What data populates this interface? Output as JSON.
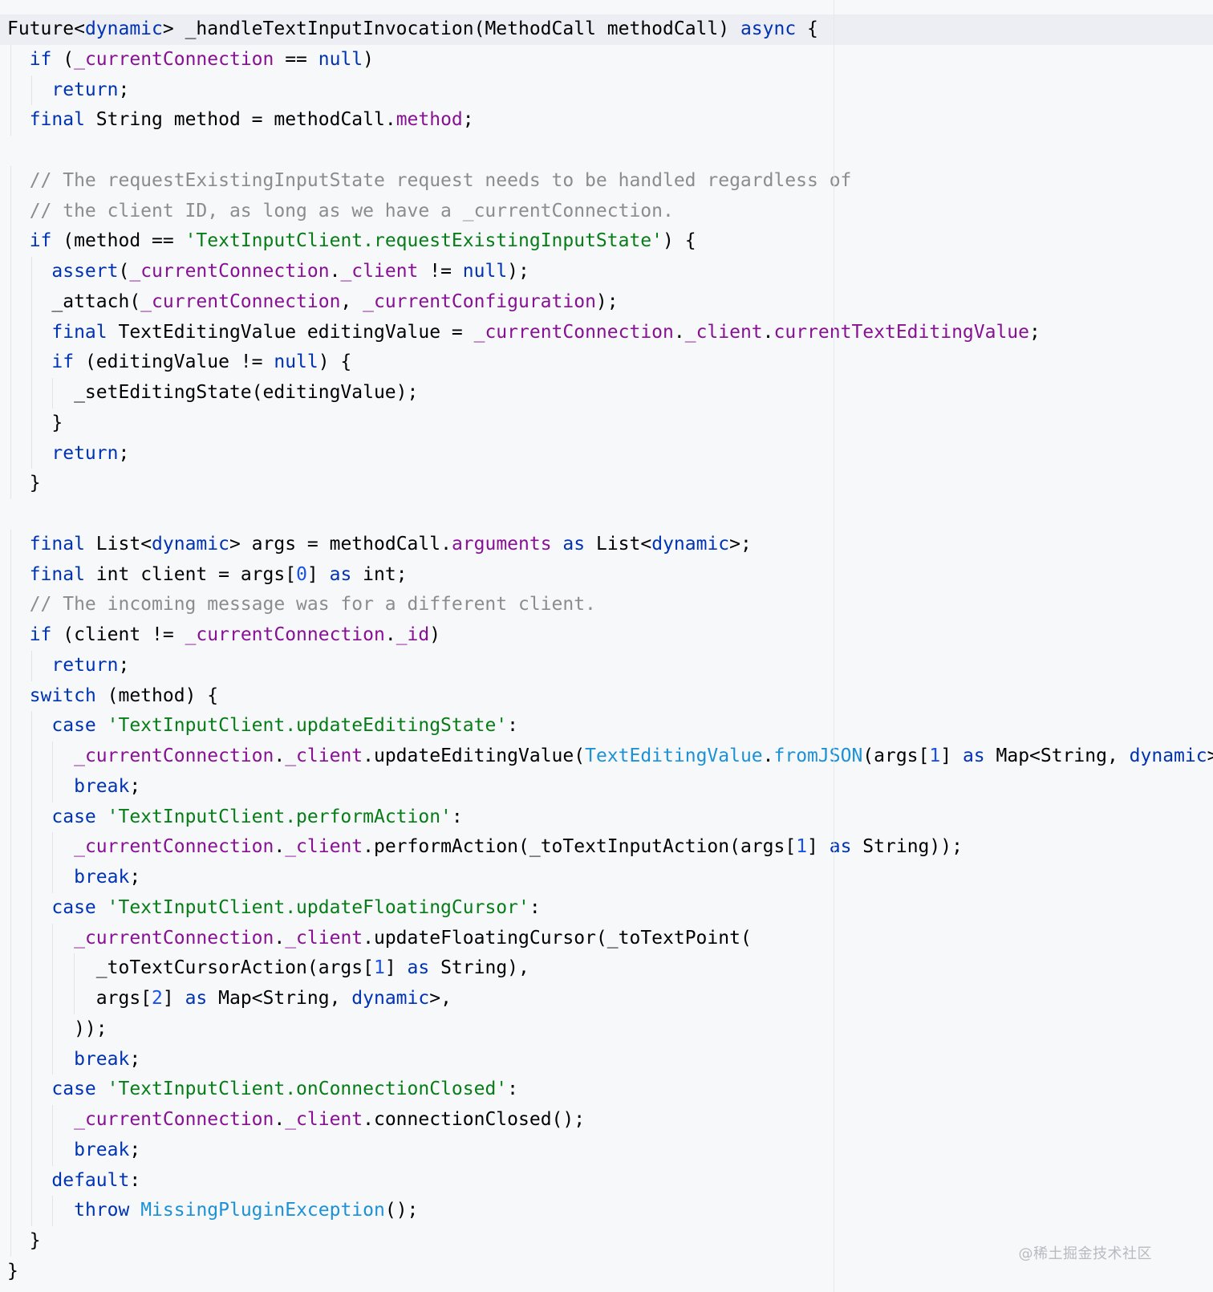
{
  "editor": {
    "language": "dart",
    "lines": [
      [
        {
          "t": "Future<",
          "c": "ty"
        },
        {
          "t": "dynamic",
          "c": "kw"
        },
        {
          "t": "> _handleTextInputInvocation(MethodCall methodCall) ",
          "c": "ty"
        },
        {
          "t": "async",
          "c": "kw"
        },
        {
          "t": " {",
          "c": "ty"
        }
      ],
      [
        {
          "t": "  ",
          "c": "ty"
        },
        {
          "t": "if",
          "c": "kw"
        },
        {
          "t": " (",
          "c": "ty"
        },
        {
          "t": "_currentConnection",
          "c": "fld"
        },
        {
          "t": " == ",
          "c": "ty"
        },
        {
          "t": "null",
          "c": "kw"
        },
        {
          "t": ")",
          "c": "ty"
        }
      ],
      [
        {
          "t": "    ",
          "c": "ty"
        },
        {
          "t": "return",
          "c": "kw"
        },
        {
          "t": ";",
          "c": "ty"
        }
      ],
      [
        {
          "t": "  ",
          "c": "ty"
        },
        {
          "t": "final",
          "c": "kw"
        },
        {
          "t": " String method = methodCall.",
          "c": "ty"
        },
        {
          "t": "method",
          "c": "fld"
        },
        {
          "t": ";",
          "c": "ty"
        }
      ],
      [],
      [
        {
          "t": "  // The requestExistingInputState request needs to be handled regardless of",
          "c": "cmt"
        }
      ],
      [
        {
          "t": "  // the client ID, as long as we have a _currentConnection.",
          "c": "cmt"
        }
      ],
      [
        {
          "t": "  ",
          "c": "ty"
        },
        {
          "t": "if",
          "c": "kw"
        },
        {
          "t": " (method == ",
          "c": "ty"
        },
        {
          "t": "'TextInputClient.requestExistingInputState'",
          "c": "str"
        },
        {
          "t": ") {",
          "c": "ty"
        }
      ],
      [
        {
          "t": "    ",
          "c": "ty"
        },
        {
          "t": "assert",
          "c": "kw"
        },
        {
          "t": "(",
          "c": "ty"
        },
        {
          "t": "_currentConnection",
          "c": "fld"
        },
        {
          "t": ".",
          "c": "ty"
        },
        {
          "t": "_client",
          "c": "fld"
        },
        {
          "t": " != ",
          "c": "ty"
        },
        {
          "t": "null",
          "c": "kw"
        },
        {
          "t": ");",
          "c": "ty"
        }
      ],
      [
        {
          "t": "    _attach(",
          "c": "ty"
        },
        {
          "t": "_currentConnection",
          "c": "fld"
        },
        {
          "t": ", ",
          "c": "ty"
        },
        {
          "t": "_currentConfiguration",
          "c": "fld"
        },
        {
          "t": ");",
          "c": "ty"
        }
      ],
      [
        {
          "t": "    ",
          "c": "ty"
        },
        {
          "t": "final",
          "c": "kw"
        },
        {
          "t": " TextEditingValue editingValue = ",
          "c": "ty"
        },
        {
          "t": "_currentConnection",
          "c": "fld"
        },
        {
          "t": ".",
          "c": "ty"
        },
        {
          "t": "_client",
          "c": "fld"
        },
        {
          "t": ".",
          "c": "ty"
        },
        {
          "t": "currentTextEditingValue",
          "c": "fld"
        },
        {
          "t": ";",
          "c": "ty"
        }
      ],
      [
        {
          "t": "    ",
          "c": "ty"
        },
        {
          "t": "if",
          "c": "kw"
        },
        {
          "t": " (editingValue != ",
          "c": "ty"
        },
        {
          "t": "null",
          "c": "kw"
        },
        {
          "t": ") {",
          "c": "ty"
        }
      ],
      [
        {
          "t": "      _setEditingState(editingValue);",
          "c": "ty"
        }
      ],
      [
        {
          "t": "    }",
          "c": "ty"
        }
      ],
      [
        {
          "t": "    ",
          "c": "ty"
        },
        {
          "t": "return",
          "c": "kw"
        },
        {
          "t": ";",
          "c": "ty"
        }
      ],
      [
        {
          "t": "  }",
          "c": "ty"
        }
      ],
      [],
      [
        {
          "t": "  ",
          "c": "ty"
        },
        {
          "t": "final",
          "c": "kw"
        },
        {
          "t": " List<",
          "c": "ty"
        },
        {
          "t": "dynamic",
          "c": "kw"
        },
        {
          "t": "> args = methodCall.",
          "c": "ty"
        },
        {
          "t": "arguments",
          "c": "fld"
        },
        {
          "t": " ",
          "c": "ty"
        },
        {
          "t": "as",
          "c": "kw"
        },
        {
          "t": " List<",
          "c": "ty"
        },
        {
          "t": "dynamic",
          "c": "kw"
        },
        {
          "t": ">;",
          "c": "ty"
        }
      ],
      [
        {
          "t": "  ",
          "c": "ty"
        },
        {
          "t": "final",
          "c": "kw"
        },
        {
          "t": " int client = args[",
          "c": "ty"
        },
        {
          "t": "0",
          "c": "num"
        },
        {
          "t": "] ",
          "c": "ty"
        },
        {
          "t": "as",
          "c": "kw"
        },
        {
          "t": " int;",
          "c": "ty"
        }
      ],
      [
        {
          "t": "  // The incoming message was for a different client.",
          "c": "cmt"
        }
      ],
      [
        {
          "t": "  ",
          "c": "ty"
        },
        {
          "t": "if",
          "c": "kw"
        },
        {
          "t": " (client != ",
          "c": "ty"
        },
        {
          "t": "_currentConnection",
          "c": "fld"
        },
        {
          "t": ".",
          "c": "ty"
        },
        {
          "t": "_id",
          "c": "fld"
        },
        {
          "t": ")",
          "c": "ty"
        }
      ],
      [
        {
          "t": "    ",
          "c": "ty"
        },
        {
          "t": "return",
          "c": "kw"
        },
        {
          "t": ";",
          "c": "ty"
        }
      ],
      [
        {
          "t": "  ",
          "c": "ty"
        },
        {
          "t": "switch",
          "c": "kw"
        },
        {
          "t": " (method) {",
          "c": "ty"
        }
      ],
      [
        {
          "t": "    ",
          "c": "ty"
        },
        {
          "t": "case",
          "c": "kw"
        },
        {
          "t": " ",
          "c": "ty"
        },
        {
          "t": "'TextInputClient.updateEditingState'",
          "c": "str"
        },
        {
          "t": ":",
          "c": "ty"
        }
      ],
      [
        {
          "t": "      ",
          "c": "ty"
        },
        {
          "t": "_currentConnection",
          "c": "fld"
        },
        {
          "t": ".",
          "c": "ty"
        },
        {
          "t": "_client",
          "c": "fld"
        },
        {
          "t": ".updateEditingValue(",
          "c": "ty"
        },
        {
          "t": "TextEditingValue",
          "c": "cls"
        },
        {
          "t": ".",
          "c": "ty"
        },
        {
          "t": "fromJSON",
          "c": "cls"
        },
        {
          "t": "(args[",
          "c": "ty"
        },
        {
          "t": "1",
          "c": "num"
        },
        {
          "t": "] ",
          "c": "ty"
        },
        {
          "t": "as",
          "c": "kw"
        },
        {
          "t": " Map<String, ",
          "c": "ty"
        },
        {
          "t": "dynamic",
          "c": "kw"
        },
        {
          "t": ">));",
          "c": "ty"
        }
      ],
      [
        {
          "t": "      ",
          "c": "ty"
        },
        {
          "t": "break",
          "c": "kw"
        },
        {
          "t": ";",
          "c": "ty"
        }
      ],
      [
        {
          "t": "    ",
          "c": "ty"
        },
        {
          "t": "case",
          "c": "kw"
        },
        {
          "t": " ",
          "c": "ty"
        },
        {
          "t": "'TextInputClient.performAction'",
          "c": "str"
        },
        {
          "t": ":",
          "c": "ty"
        }
      ],
      [
        {
          "t": "      ",
          "c": "ty"
        },
        {
          "t": "_currentConnection",
          "c": "fld"
        },
        {
          "t": ".",
          "c": "ty"
        },
        {
          "t": "_client",
          "c": "fld"
        },
        {
          "t": ".performAction(_toTextInputAction(args[",
          "c": "ty"
        },
        {
          "t": "1",
          "c": "num"
        },
        {
          "t": "] ",
          "c": "ty"
        },
        {
          "t": "as",
          "c": "kw"
        },
        {
          "t": " String));",
          "c": "ty"
        }
      ],
      [
        {
          "t": "      ",
          "c": "ty"
        },
        {
          "t": "break",
          "c": "kw"
        },
        {
          "t": ";",
          "c": "ty"
        }
      ],
      [
        {
          "t": "    ",
          "c": "ty"
        },
        {
          "t": "case",
          "c": "kw"
        },
        {
          "t": " ",
          "c": "ty"
        },
        {
          "t": "'TextInputClient.updateFloatingCursor'",
          "c": "str"
        },
        {
          "t": ":",
          "c": "ty"
        }
      ],
      [
        {
          "t": "      ",
          "c": "ty"
        },
        {
          "t": "_currentConnection",
          "c": "fld"
        },
        {
          "t": ".",
          "c": "ty"
        },
        {
          "t": "_client",
          "c": "fld"
        },
        {
          "t": ".updateFloatingCursor(_toTextPoint(",
          "c": "ty"
        }
      ],
      [
        {
          "t": "        _toTextCursorAction(args[",
          "c": "ty"
        },
        {
          "t": "1",
          "c": "num"
        },
        {
          "t": "] ",
          "c": "ty"
        },
        {
          "t": "as",
          "c": "kw"
        },
        {
          "t": " String),",
          "c": "ty"
        }
      ],
      [
        {
          "t": "        args[",
          "c": "ty"
        },
        {
          "t": "2",
          "c": "num"
        },
        {
          "t": "] ",
          "c": "ty"
        },
        {
          "t": "as",
          "c": "kw"
        },
        {
          "t": " Map<String, ",
          "c": "ty"
        },
        {
          "t": "dynamic",
          "c": "kw"
        },
        {
          "t": ">,",
          "c": "ty"
        }
      ],
      [
        {
          "t": "      ));",
          "c": "ty"
        }
      ],
      [
        {
          "t": "      ",
          "c": "ty"
        },
        {
          "t": "break",
          "c": "kw"
        },
        {
          "t": ";",
          "c": "ty"
        }
      ],
      [
        {
          "t": "    ",
          "c": "ty"
        },
        {
          "t": "case",
          "c": "kw"
        },
        {
          "t": " ",
          "c": "ty"
        },
        {
          "t": "'TextInputClient.onConnectionClosed'",
          "c": "str"
        },
        {
          "t": ":",
          "c": "ty"
        }
      ],
      [
        {
          "t": "      ",
          "c": "ty"
        },
        {
          "t": "_currentConnection",
          "c": "fld"
        },
        {
          "t": ".",
          "c": "ty"
        },
        {
          "t": "_client",
          "c": "fld"
        },
        {
          "t": ".connectionClosed();",
          "c": "ty"
        }
      ],
      [
        {
          "t": "      ",
          "c": "ty"
        },
        {
          "t": "break",
          "c": "kw"
        },
        {
          "t": ";",
          "c": "ty"
        }
      ],
      [
        {
          "t": "    ",
          "c": "ty"
        },
        {
          "t": "default",
          "c": "kw"
        },
        {
          "t": ":",
          "c": "ty"
        }
      ],
      [
        {
          "t": "      ",
          "c": "ty"
        },
        {
          "t": "throw",
          "c": "kw"
        },
        {
          "t": " ",
          "c": "ty"
        },
        {
          "t": "MissingPluginException",
          "c": "cls"
        },
        {
          "t": "();",
          "c": "ty"
        }
      ],
      [
        {
          "t": "  }",
          "c": "ty"
        }
      ],
      [
        {
          "t": "}",
          "c": "ty"
        }
      ]
    ],
    "highlighted_line_index": 0
  },
  "watermark": "@稀土掘金技术社区"
}
